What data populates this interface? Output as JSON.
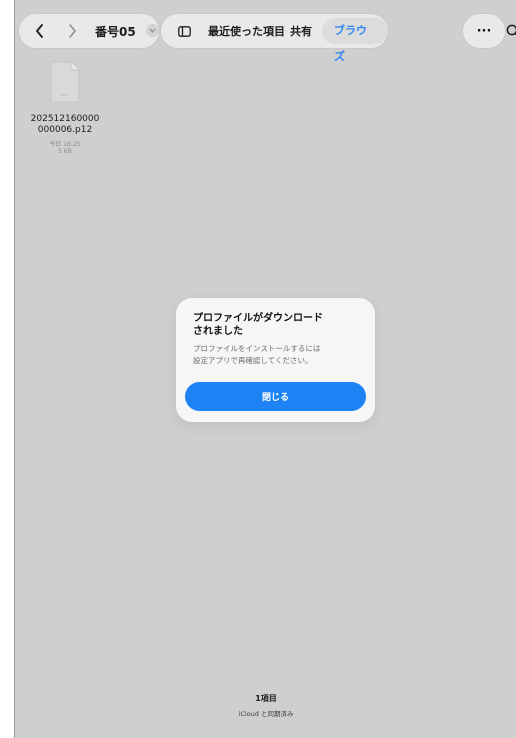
{
  "toolbar": {
    "breadcrumb": "番号05",
    "tabs": [
      "最近使った項目",
      "共有",
      "ブラウズ"
    ],
    "active_tab": "ブラウズ",
    "more_label": "···"
  },
  "file": {
    "name_line1": "202512160000",
    "name_line2": "000006.p12",
    "icon_text": "P12",
    "date": "今日 16:25",
    "size": "5 KB"
  },
  "dialog": {
    "title_line1": "プロファイルがダウンロード",
    "title_line2": "されました",
    "message_line1": "プロファイルをインストールするには",
    "message_line2": "設定アプリで再確認してください。",
    "close_label": "閉じる"
  },
  "footer": {
    "item_count": "1項目",
    "sync_status": "iCloud と同期済み"
  },
  "colors": {
    "accent": "#1d83f5",
    "background": "#cfcfcf"
  }
}
